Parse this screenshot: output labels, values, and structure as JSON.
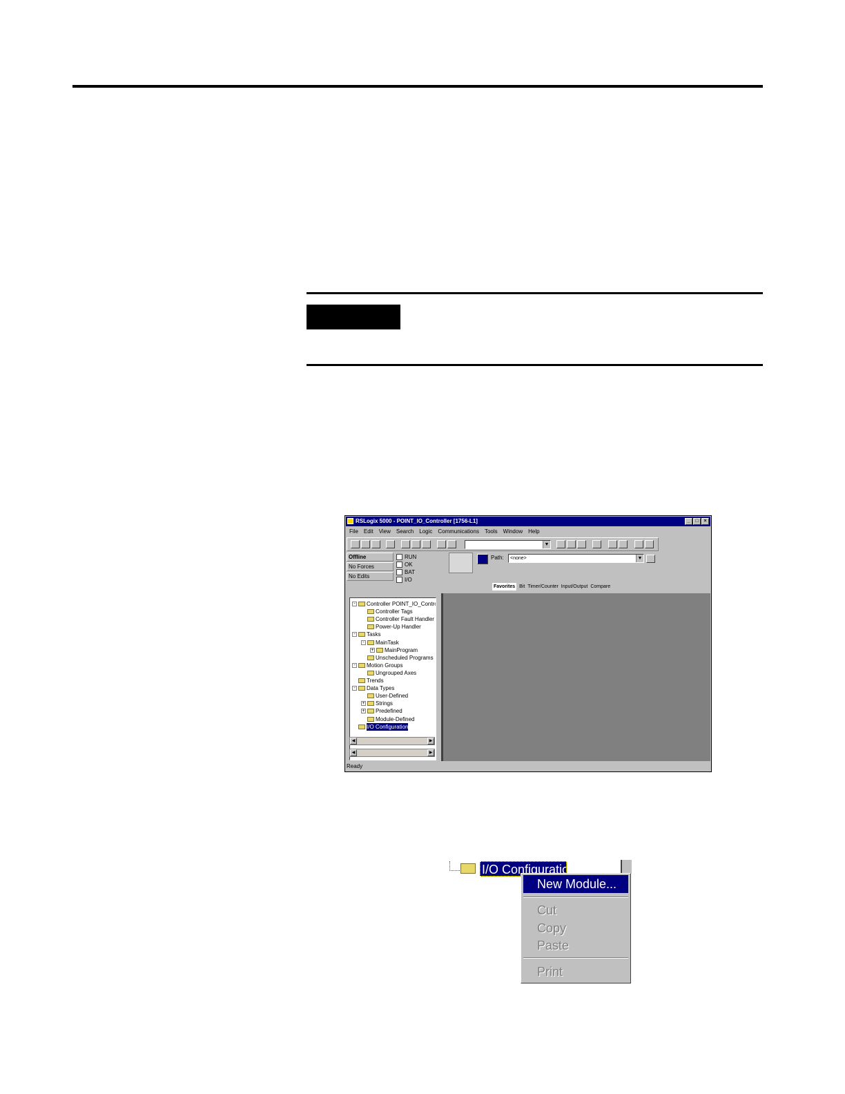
{
  "window": {
    "title": "RSLogix 5000 - POINT_IO_Controller [1756-L1]",
    "menus": [
      "File",
      "Edit",
      "View",
      "Search",
      "Logic",
      "Communications",
      "Tools",
      "Window",
      "Help"
    ],
    "status_panel": {
      "mode": "Offline",
      "forces": "No Forces",
      "edits": "No Edits"
    },
    "indicators": [
      "RUN",
      "OK",
      "BAT",
      "I/O"
    ],
    "path_label": "Path:",
    "path_value": "<none>",
    "instruction_tabs": [
      "Favorites",
      "Bit",
      "Timer/Counter",
      "Input/Output",
      "Compare"
    ],
    "tree": [
      {
        "label": "Controller POINT_IO_Controller",
        "level": 0,
        "expander": "-"
      },
      {
        "label": "Controller Tags",
        "level": 1,
        "expander": ""
      },
      {
        "label": "Controller Fault Handler",
        "level": 1,
        "expander": ""
      },
      {
        "label": "Power-Up Handler",
        "level": 1,
        "expander": ""
      },
      {
        "label": "Tasks",
        "level": 0,
        "expander": "-"
      },
      {
        "label": "MainTask",
        "level": 1,
        "expander": "-"
      },
      {
        "label": "MainProgram",
        "level": 2,
        "expander": "+"
      },
      {
        "label": "Unscheduled Programs",
        "level": 1,
        "expander": ""
      },
      {
        "label": "Motion Groups",
        "level": 0,
        "expander": "-"
      },
      {
        "label": "Ungrouped Axes",
        "level": 1,
        "expander": ""
      },
      {
        "label": "Trends",
        "level": 0,
        "expander": ""
      },
      {
        "label": "Data Types",
        "level": 0,
        "expander": "-"
      },
      {
        "label": "User-Defined",
        "level": 1,
        "expander": ""
      },
      {
        "label": "Strings",
        "level": 1,
        "expander": "+"
      },
      {
        "label": "Predefined",
        "level": 1,
        "expander": "+"
      },
      {
        "label": "Module-Defined",
        "level": 1,
        "expander": ""
      },
      {
        "label": "I/O Configuration",
        "level": 0,
        "expander": "",
        "selected": true
      }
    ],
    "statusbar": "Ready"
  },
  "context": {
    "node_label": "I/O Configuration",
    "menu": {
      "new_module": "New Module...",
      "cut": "Cut",
      "copy": "Copy",
      "paste": "Paste",
      "print": "Print"
    }
  }
}
